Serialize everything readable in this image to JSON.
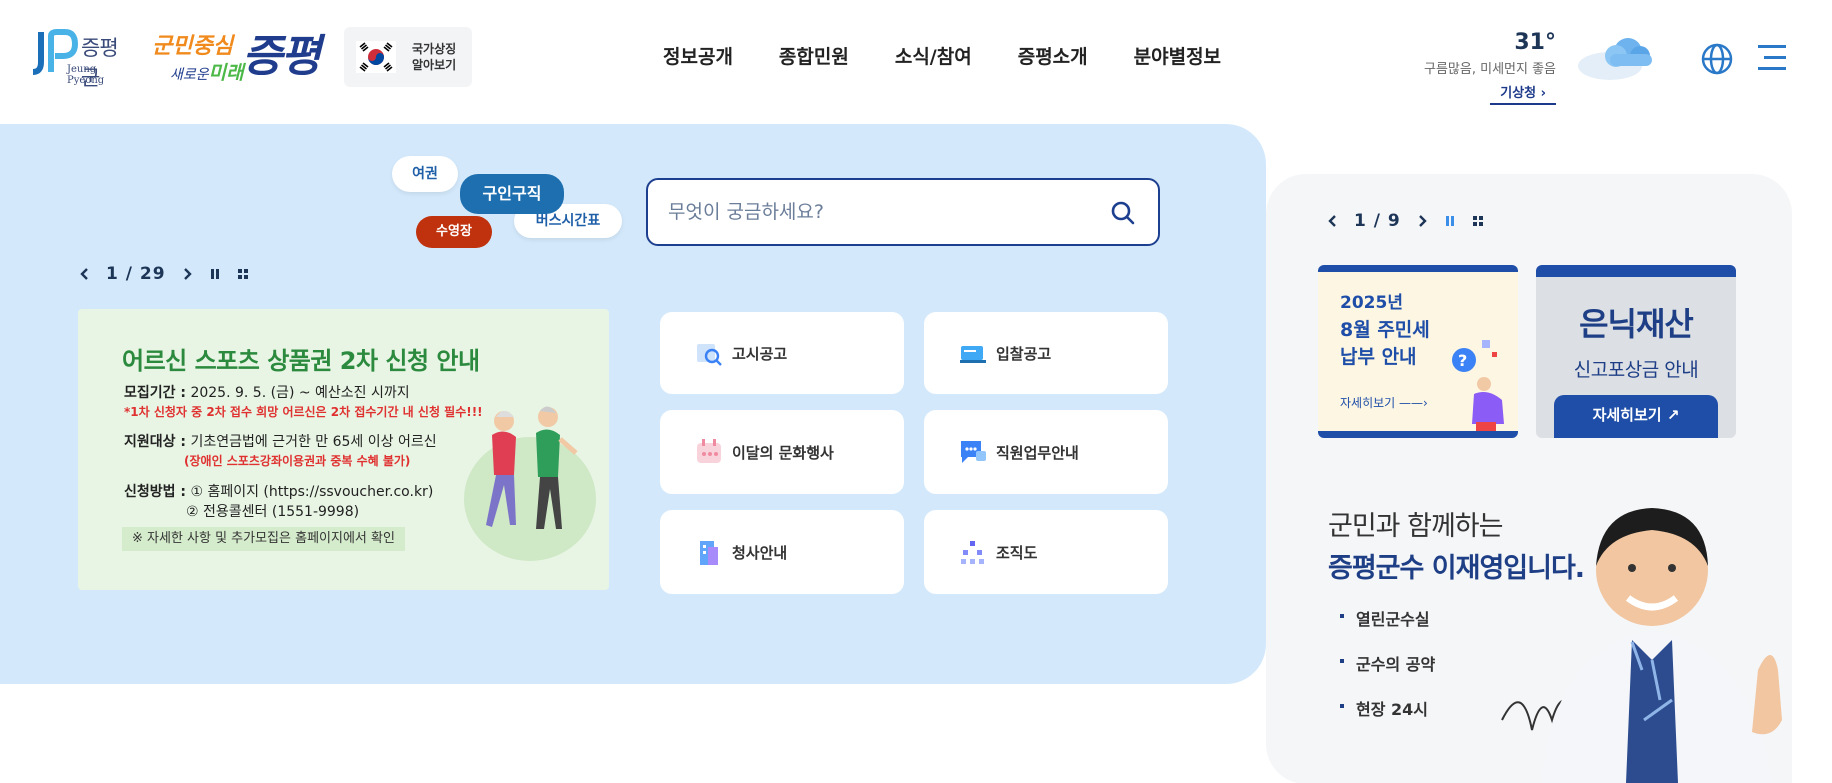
{
  "header": {
    "logo": {
      "name": "증평군",
      "en": "Jeung Pyeong"
    },
    "slogan": {
      "line1": "군민중심",
      "line2a": "새로운",
      "line2b": "미래",
      "main": "증평"
    },
    "symbol_button": {
      "line1": "국가상징",
      "line2": "알아보기"
    },
    "nav": [
      "정보공개",
      "종합민원",
      "소식/참여",
      "증평소개",
      "분야별정보"
    ],
    "weather": {
      "temp": "31°",
      "desc": "구름많음, 미세먼지 좋음",
      "link": "기상청 ›"
    }
  },
  "tags": {
    "passport": "여권",
    "jobs": "구인구직",
    "bus": "버스시간표",
    "pool": "수영장"
  },
  "search": {
    "placeholder": "무엇이 궁금하세요?"
  },
  "main_slider": {
    "counter": "1 / 29"
  },
  "banner": {
    "title": "어르신 스포츠 상품권 2차 신청 안내",
    "period_label": "모집기간 :",
    "period": "2025. 9. 5. (금) ~ 예산소진 시까지",
    "period_note": "*1차 신청자 중 2차 접수 희망 어르신은 2차 접수기간 내 신청 필수!!!",
    "target_label": "지원대상 :",
    "target": "기초연금법에 근거한 만 65세 이상 어르신",
    "target_note": "(장애인 스포츠강좌이용권과 중복 수혜 불가)",
    "method_label": "신청방법 :",
    "method1": "① 홈페이지 (https://ssvoucher.co.kr)",
    "method2": "② 전용콜센터 (1551-9998)",
    "note": "※ 자세한 사항 및 추가모집은 홈페이지에서 확인"
  },
  "quick_links": [
    {
      "label": "고시공고",
      "icon": "notice-search-icon"
    },
    {
      "label": "입찰공고",
      "icon": "bid-icon"
    },
    {
      "label": "이달의 문화행사",
      "icon": "calendar-icon"
    },
    {
      "label": "직원업무안내",
      "icon": "chat-icon"
    },
    {
      "label": "청사안내",
      "icon": "building-icon"
    },
    {
      "label": "조직도",
      "icon": "org-chart-icon"
    }
  ],
  "side_slider": {
    "counter": "1 / 9"
  },
  "side_banners": {
    "tax": {
      "line1": "2025년",
      "line2": "8월 주민세",
      "line3": "납부 안내",
      "more": "자세히보기 ——›"
    },
    "hidden": {
      "title": "은닉재산",
      "subtitle": "신고포상금 안내",
      "button": "자세히보기"
    }
  },
  "mayor": {
    "line1": "군민과 함께하는",
    "line2": "증평군수 이재영입니다.",
    "links": [
      "열린군수실",
      "군수의 공약",
      "현장 24시"
    ]
  },
  "colors": {
    "panel_blue": "#d3e9fb",
    "navy": "#1e3f86",
    "accent_red": "#c0320e"
  }
}
